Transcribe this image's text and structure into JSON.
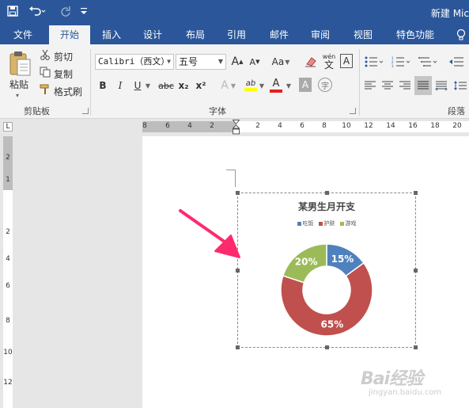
{
  "window": {
    "title": "新建 Mic"
  },
  "colors": {
    "brand": "#2b579a",
    "slice_blue": "#4f81bd",
    "slice_red": "#c0504d",
    "slice_green": "#9bbb59",
    "arrow": "#ff2a6d"
  },
  "quick_access": {
    "icons": [
      "save-icon",
      "undo-icon",
      "redo-icon",
      "customize-icon"
    ]
  },
  "tabs": [
    {
      "label": "文件"
    },
    {
      "label": "开始"
    },
    {
      "label": "插入"
    },
    {
      "label": "设计"
    },
    {
      "label": "布局"
    },
    {
      "label": "引用"
    },
    {
      "label": "邮件"
    },
    {
      "label": "审阅"
    },
    {
      "label": "视图"
    },
    {
      "label": "特色功能"
    }
  ],
  "clipboard": {
    "paste_label": "粘贴",
    "cut_label": "剪切",
    "copy_label": "复制",
    "format_painter_label": "格式刷",
    "group_label": "剪贴板"
  },
  "font": {
    "font_name": "Calibri（西文）",
    "font_size": "五号",
    "aa_label": "Aa",
    "wen_label": "wén",
    "wen_char": "文",
    "boxed_a": "A",
    "group_label": "字体",
    "format_labels": {
      "bold": "B",
      "italic": "I",
      "underline": "U",
      "strike": "abc",
      "sub": "x₂",
      "sup": "x²",
      "effects": "A",
      "highlight": "ab",
      "color": "A",
      "shade": "A",
      "circled": "字"
    }
  },
  "paragraph": {
    "group_label": "段落"
  },
  "ruler": {
    "h_ticks": [
      "8",
      "6",
      "4",
      "2",
      "2",
      "4",
      "6",
      "8",
      "10",
      "12",
      "14",
      "16",
      "18",
      "20"
    ],
    "v_ticks": [
      "2",
      "1",
      "2",
      "4",
      "6",
      "8",
      "10",
      "12"
    ]
  },
  "chart_data": {
    "type": "pie",
    "title": "某男生月开支",
    "categories": [
      "吃饭",
      "护肤",
      "游戏"
    ],
    "values": [
      15,
      65,
      20
    ],
    "labels": [
      "15%",
      "65%",
      "20%"
    ],
    "colors": [
      "#4f81bd",
      "#c0504d",
      "#9bbb59"
    ],
    "donut": true,
    "legend": "top"
  },
  "watermark": {
    "text": "Bai经验",
    "url": "jingyan.baidu.com"
  }
}
